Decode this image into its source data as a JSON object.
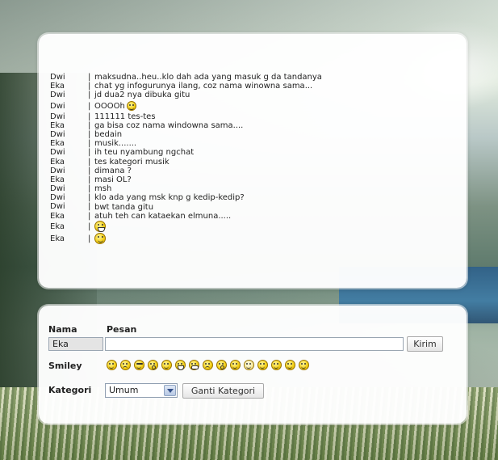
{
  "chat": {
    "messages": [
      {
        "nick": "Dwi",
        "text": "maksudna..heu..klo dah ada yang masuk g da tandanya",
        "smiley": ""
      },
      {
        "nick": "Eka",
        "text": "chat yg infogurunya ilang, coz nama winowna sama...",
        "smiley": ""
      },
      {
        "nick": "Dwi",
        "text": "jd dua2 nya dibuka gitu",
        "smiley": ""
      },
      {
        "nick": "Dwi",
        "text": "OOOOh",
        "smiley": "smile-icon"
      },
      {
        "nick": "Dwi",
        "text": "111111 tes-tes",
        "smiley": ""
      },
      {
        "nick": "Eka",
        "text": "ga bisa coz nama windowna sama....",
        "smiley": ""
      },
      {
        "nick": "Dwi",
        "text": "bedain",
        "smiley": ""
      },
      {
        "nick": "Eka",
        "text": "musik.......",
        "smiley": ""
      },
      {
        "nick": "Dwi",
        "text": "ih teu nyambung ngchat",
        "smiley": ""
      },
      {
        "nick": "Eka",
        "text": "tes kategori musik",
        "smiley": ""
      },
      {
        "nick": "Dwi",
        "text": "dimana ?",
        "smiley": ""
      },
      {
        "nick": "Eka",
        "text": "masi OL?",
        "smiley": ""
      },
      {
        "nick": "Dwi",
        "text": "msh",
        "smiley": ""
      },
      {
        "nick": "Dwi",
        "text": "klo ada yang msk knp g kedip-kedip?",
        "smiley": ""
      },
      {
        "nick": "Dwi",
        "text": "bwt tanda gitu",
        "smiley": ""
      },
      {
        "nick": "Eka",
        "text": "atuh teh can kataekan elmuna.....",
        "smiley": ""
      },
      {
        "nick": "Eka",
        "text": "",
        "smiley": "laugh-icon"
      },
      {
        "nick": "Eka",
        "text": "",
        "smiley": "smile-icon"
      }
    ],
    "separator": "|"
  },
  "form": {
    "nama_label": "Nama",
    "pesan_label": "Pesan",
    "nama_value": "Eka",
    "pesan_value": "",
    "kirim_label": "Kirim",
    "smiley_label": "Smiley",
    "smileys": [
      "smile-icon",
      "sad-icon",
      "cool-icon",
      "wow-icon",
      "smile-icon",
      "laugh-icon",
      "grin-icon",
      "sad-icon",
      "wow-icon",
      "smile-icon",
      "plain-icon",
      "smile-icon",
      "smile-icon",
      "smile-icon",
      "smile-icon"
    ],
    "kategori_label": "Kategori",
    "kategori_value": "Umum",
    "ganti_label": "Ganti Kategori"
  }
}
